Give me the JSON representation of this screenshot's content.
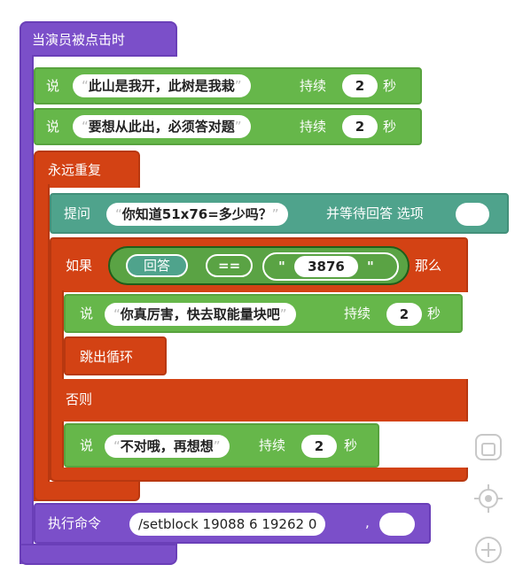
{
  "hat": {
    "label": "当演员被点击时"
  },
  "say1": {
    "verb": "说",
    "text": "此山是我开，此树是我栽",
    "duration_label": "持续",
    "duration": "2",
    "unit": "秒"
  },
  "say2": {
    "verb": "说",
    "text": "要想从此出，必须答对题",
    "duration_label": "持续",
    "duration": "2",
    "unit": "秒"
  },
  "forever": {
    "label": "永远重复"
  },
  "ask": {
    "verb": "提问",
    "text": "你知道51x76=多少吗？",
    "suffix": "并等待回答 选项"
  },
  "if_block": {
    "if_label": "如果",
    "answer": "回答",
    "operator": "==",
    "quote_open": "\"",
    "value": "3876",
    "quote_close": "\"",
    "then_label": "那么"
  },
  "say3": {
    "verb": "说",
    "text": "你真厉害，快去取能量块吧",
    "duration_label": "持续",
    "duration": "2",
    "unit": "秒"
  },
  "break": {
    "label": "跳出循环"
  },
  "else": {
    "label": "否则"
  },
  "say4": {
    "verb": "说",
    "text": "不对哦，再想想",
    "duration_label": "持续",
    "duration": "2",
    "unit": "秒"
  },
  "exec": {
    "label": "执行命令",
    "command": "/setblock 19088 6 19262 0",
    "separator": ","
  },
  "colors": {
    "events": "#7b4fc9",
    "looks": "#66b74a",
    "control": "#d34214",
    "sensing": "#4fa38c"
  },
  "controls": [
    "stop-square-icon",
    "crosshair-icon",
    "zoom-in-icon"
  ]
}
